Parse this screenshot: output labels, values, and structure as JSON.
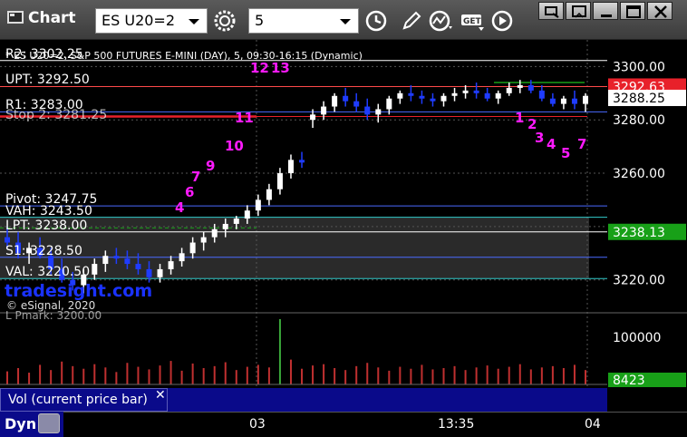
{
  "window": {
    "title": "Chart",
    "symbol": "ES U20=2",
    "interval": "5"
  },
  "chart_header": {
    "description": "* ES U20=2, S&P 500 FUTURES E-MINI (DAY), 5, 09:30-16:15 (Dynamic)",
    "watermark": "tradesight.com",
    "copyright": "© eSignal, 2020"
  },
  "colors": {
    "up": "#ffffff",
    "down": "#1f3cff",
    "volume": "#c03030",
    "marker_magenta": "#ff1aff",
    "marker_green": "#28a828",
    "price_red": "#e8212a",
    "price_green": "#18a018"
  },
  "price_axis": {
    "ticks": [
      "3300.00",
      "3280.00",
      "3260.00",
      "3220.00"
    ],
    "current_high": "3292.63",
    "current_last": "3288.25",
    "current_low": "3238.13"
  },
  "volume_axis": {
    "tick": "100000",
    "current": "8423",
    "label": "Vol (current price bar)"
  },
  "levels": [
    {
      "label": "R2: 3302.25",
      "value": 3302.25,
      "color": "#ffffff"
    },
    {
      "label": "UPT: 3292.50",
      "value": 3292.5,
      "color": "#ff4a4a"
    },
    {
      "label": "R1: 3283.00",
      "value": 3283.0,
      "color": "#4a6aff"
    },
    {
      "label": "Pivot: 3247.75",
      "value": 3247.75,
      "color": "#4a6aff"
    },
    {
      "label": "VAH: 3243.50",
      "value": 3243.5,
      "color": "#33cccc"
    },
    {
      "label": "LPT: 3238.00",
      "value": 3238.0,
      "color": "#ffffff"
    },
    {
      "label": "S1: 3228.50",
      "value": 3228.5,
      "color": "#4a6aff"
    },
    {
      "label": "VAL: 3220.50",
      "value": 3220.5,
      "color": "#33cccc"
    }
  ],
  "overlaps": [
    {
      "label": "Stop 2: 3281.25"
    },
    {
      "label": "L Pmark: 3200.00"
    }
  ],
  "time_axis": {
    "labels": [
      "03",
      "13:35",
      "04"
    ]
  },
  "bottom_bar": {
    "label": "Dyn"
  },
  "markers": [
    {
      "text": "12",
      "color": "magenta"
    },
    {
      "text": "13",
      "color": "magenta"
    },
    {
      "text": "11",
      "color": "magenta"
    },
    {
      "text": "10",
      "color": "magenta"
    },
    {
      "text": "9",
      "color": "magenta"
    },
    {
      "text": "7",
      "color": "magenta"
    },
    {
      "text": "6",
      "color": "magenta"
    },
    {
      "text": "4",
      "color": "magenta"
    },
    {
      "text": "1",
      "color": "magenta"
    },
    {
      "text": "2",
      "color": "magenta"
    },
    {
      "text": "3",
      "color": "magenta"
    },
    {
      "text": "4",
      "color": "magenta"
    },
    {
      "text": "5",
      "color": "magenta"
    },
    {
      "text": "7",
      "color": "magenta"
    }
  ],
  "chart_data": {
    "type": "candlestick",
    "title": "",
    "ylim": [
      3208,
      3310
    ],
    "bars": [
      [
        3236,
        3240,
        3232,
        3234
      ],
      [
        3234,
        3238,
        3228,
        3230
      ],
      [
        3230,
        3234,
        3226,
        3232
      ],
      [
        3232,
        3236,
        3228,
        3229
      ],
      [
        3229,
        3232,
        3222,
        3224
      ],
      [
        3224,
        3228,
        3219,
        3220
      ],
      [
        3220,
        3223,
        3216,
        3218
      ],
      [
        3218,
        3224,
        3215,
        3222
      ],
      [
        3222,
        3228,
        3220,
        3226
      ],
      [
        3226,
        3231,
        3223,
        3229
      ],
      [
        3229,
        3232,
        3226,
        3228
      ],
      [
        3228,
        3231,
        3224,
        3226
      ],
      [
        3226,
        3230,
        3222,
        3224
      ],
      [
        3224,
        3227,
        3219,
        3221
      ],
      [
        3221,
        3226,
        3219,
        3224
      ],
      [
        3224,
        3229,
        3222,
        3227
      ],
      [
        3227,
        3232,
        3225,
        3230
      ],
      [
        3230,
        3236,
        3228,
        3234
      ],
      [
        3234,
        3238,
        3231,
        3236
      ],
      [
        3236,
        3241,
        3234,
        3239
      ],
      [
        3239,
        3243,
        3236,
        3241
      ],
      [
        3241,
        3244,
        3239,
        3243
      ],
      [
        3243,
        3248,
        3241,
        3246
      ],
      [
        3246,
        3252,
        3244,
        3250
      ],
      [
        3250,
        3256,
        3248,
        3254
      ],
      [
        3254,
        3262,
        3252,
        3260
      ],
      [
        3260,
        3267,
        3258,
        3265
      ],
      [
        3265,
        3268,
        3262,
        3264
      ],
      [
        3280,
        3284,
        3277,
        3282
      ],
      [
        3282,
        3287,
        3280,
        3285
      ],
      [
        3285,
        3290,
        3283,
        3289
      ],
      [
        3289,
        3292,
        3285,
        3287
      ],
      [
        3287,
        3290,
        3283,
        3285
      ],
      [
        3285,
        3288,
        3280,
        3282
      ],
      [
        3282,
        3286,
        3279,
        3284
      ],
      [
        3284,
        3289,
        3282,
        3288
      ],
      [
        3288,
        3291,
        3286,
        3290
      ],
      [
        3290,
        3293,
        3287,
        3289
      ],
      [
        3289,
        3291,
        3286,
        3288
      ],
      [
        3288,
        3290,
        3285,
        3287
      ],
      [
        3287,
        3290,
        3285,
        3289
      ],
      [
        3289,
        3292,
        3287,
        3290
      ],
      [
        3290,
        3293,
        3288,
        3291
      ],
      [
        3291,
        3294,
        3288,
        3290
      ],
      [
        3290,
        3292,
        3287,
        3288
      ],
      [
        3288,
        3291,
        3286,
        3290
      ],
      [
        3290,
        3294,
        3289,
        3292
      ],
      [
        3292,
        3295,
        3290,
        3293
      ],
      [
        3293,
        3295,
        3290,
        3291
      ],
      [
        3291,
        3293,
        3287,
        3288
      ],
      [
        3288,
        3290,
        3285,
        3286
      ],
      [
        3286,
        3289,
        3284,
        3288
      ],
      [
        3288,
        3291,
        3284,
        3286
      ],
      [
        3286,
        3290,
        3283,
        3289
      ]
    ],
    "volume": [
      20,
      25,
      18,
      30,
      22,
      35,
      28,
      24,
      31,
      26,
      19,
      33,
      27,
      23,
      29,
      36,
      21,
      32,
      25,
      28,
      34,
      22,
      27,
      30,
      26,
      100,
      38,
      24,
      29,
      31,
      25,
      22,
      28,
      33,
      26,
      21,
      27,
      24,
      30,
      23,
      25,
      28,
      22,
      26,
      29,
      24,
      27,
      31,
      23,
      26,
      28,
      25,
      30,
      22
    ]
  }
}
